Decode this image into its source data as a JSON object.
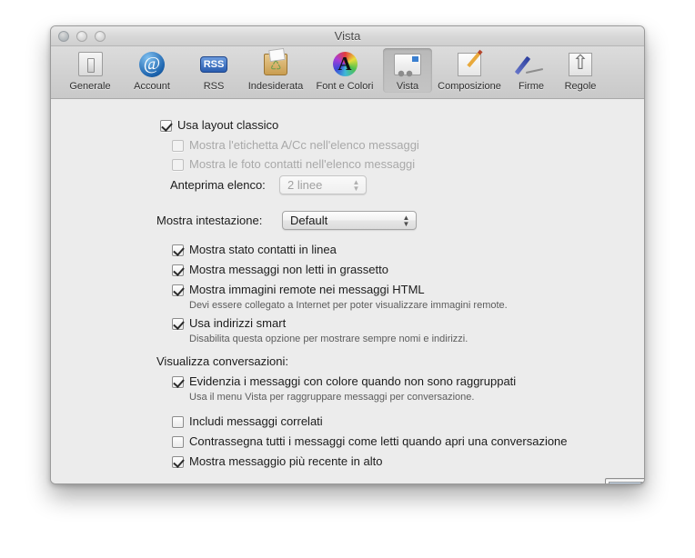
{
  "window": {
    "title": "Vista",
    "traffic_lights": [
      "close",
      "minimize",
      "zoom"
    ]
  },
  "toolbar": {
    "items": [
      {
        "label": "Generale",
        "icon": "general-icon",
        "selected": false
      },
      {
        "label": "Account",
        "icon": "at-sign-icon",
        "selected": false
      },
      {
        "label": "RSS",
        "icon": "rss-icon",
        "selected": false
      },
      {
        "label": "Indesiderata",
        "icon": "junk-mail-icon",
        "selected": false
      },
      {
        "label": "Font e Colori",
        "icon": "font-color-icon",
        "selected": false
      },
      {
        "label": "Vista",
        "icon": "viewing-icon",
        "selected": true
      },
      {
        "label": "Composizione",
        "icon": "compose-icon",
        "selected": false
      },
      {
        "label": "Firme",
        "icon": "signature-icon",
        "selected": false
      },
      {
        "label": "Regole",
        "icon": "rules-icon",
        "selected": false
      }
    ]
  },
  "main": {
    "use_classic_layout": {
      "label": "Usa layout classico",
      "checked": true,
      "disabled": false
    },
    "show_to_cc_label": {
      "label": "Mostra l'etichetta A/Cc nell'elenco messaggi",
      "checked": false,
      "disabled": true
    },
    "show_contact_photos": {
      "label": "Mostra le foto contatti nell'elenco messaggi",
      "checked": false,
      "disabled": true
    },
    "list_preview": {
      "label": "Anteprima elenco:",
      "value": "2 linee",
      "disabled": true
    },
    "show_header": {
      "label": "Mostra intestazione:",
      "value": "Default",
      "disabled": false
    },
    "show_online_status": {
      "label": "Mostra stato contatti in linea",
      "checked": true,
      "disabled": false
    },
    "show_unread_bold": {
      "label": "Mostra messaggi non letti in grassetto",
      "checked": true,
      "disabled": false
    },
    "show_remote_images": {
      "label": "Mostra immagini remote nei messaggi HTML",
      "checked": true,
      "disabled": false,
      "hint": "Devi essere collegato a Internet per poter visualizzare immagini remote."
    },
    "use_smart_addresses": {
      "label": "Usa indirizzi smart",
      "checked": true,
      "disabled": false,
      "hint": "Disabilita questa opzione per mostrare sempre nomi e indirizzi."
    },
    "conversations_section_label": "Visualizza conversazioni:",
    "highlight_messages": {
      "label": "Evidenzia i messaggi con colore quando non sono raggruppati",
      "checked": true,
      "disabled": false,
      "hint": "Usa il menu Vista per raggruppare messaggi per conversazione.",
      "color": "#c5d9ef"
    },
    "include_related": {
      "label": "Includi messaggi correlati",
      "checked": false,
      "disabled": false
    },
    "mark_all_read": {
      "label": "Contrassegna tutti i messaggi come letti quando apri una conversazione",
      "checked": false,
      "disabled": false
    },
    "show_most_recent_top": {
      "label": "Mostra messaggio più recente in alto",
      "checked": true,
      "disabled": false
    },
    "help_label": "?"
  }
}
